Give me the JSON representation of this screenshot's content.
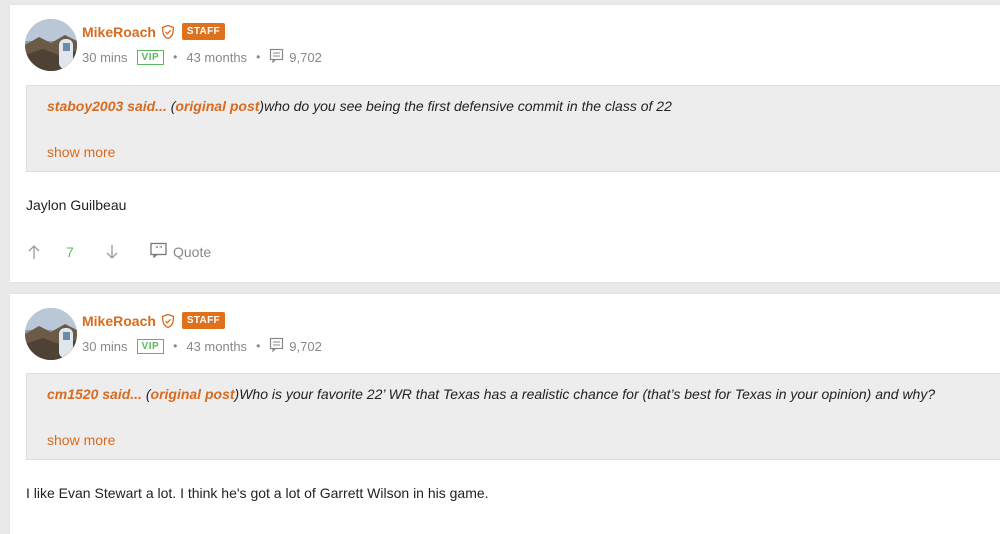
{
  "posts": [
    {
      "author": "MikeRoach",
      "badge": "STAFF",
      "time_ago": "30 mins",
      "vip": "VIP",
      "tenure": "43 months",
      "post_count": "9,702",
      "quote": {
        "user": "staboy2003 said...",
        "open_paren": " (",
        "link": "original post",
        "close_paren": ")",
        "text": "who do you see being the first defensive commit in the class of 22",
        "show_more": "show more"
      },
      "body": "Jaylon Guilbeau",
      "votes": "7",
      "quote_label": "Quote"
    },
    {
      "author": "MikeRoach",
      "badge": "STAFF",
      "time_ago": "30 mins",
      "vip": "VIP",
      "tenure": "43 months",
      "post_count": "9,702",
      "quote": {
        "user": "cm1520 said...",
        "open_paren": " (",
        "link": "original post",
        "close_paren": ")",
        "text": "Who is your favorite 22’ WR that Texas has a realistic chance for (that’s best for Texas in your opinion) and why?",
        "show_more": "show more"
      },
      "body": "I like Evan Stewart a lot. I think he's got a lot of Garrett Wilson in his game."
    }
  ],
  "colors": {
    "accent": "#d96a1f",
    "staff_badge": "#e0711c",
    "vip_green": "#5cb85c",
    "quote_bg": "#ededed",
    "page_bg": "#e9e9e9"
  },
  "icons": [
    "shield-icon",
    "comment-icon",
    "arrow-up-icon",
    "arrow-down-icon",
    "quote-bubble-icon"
  ]
}
